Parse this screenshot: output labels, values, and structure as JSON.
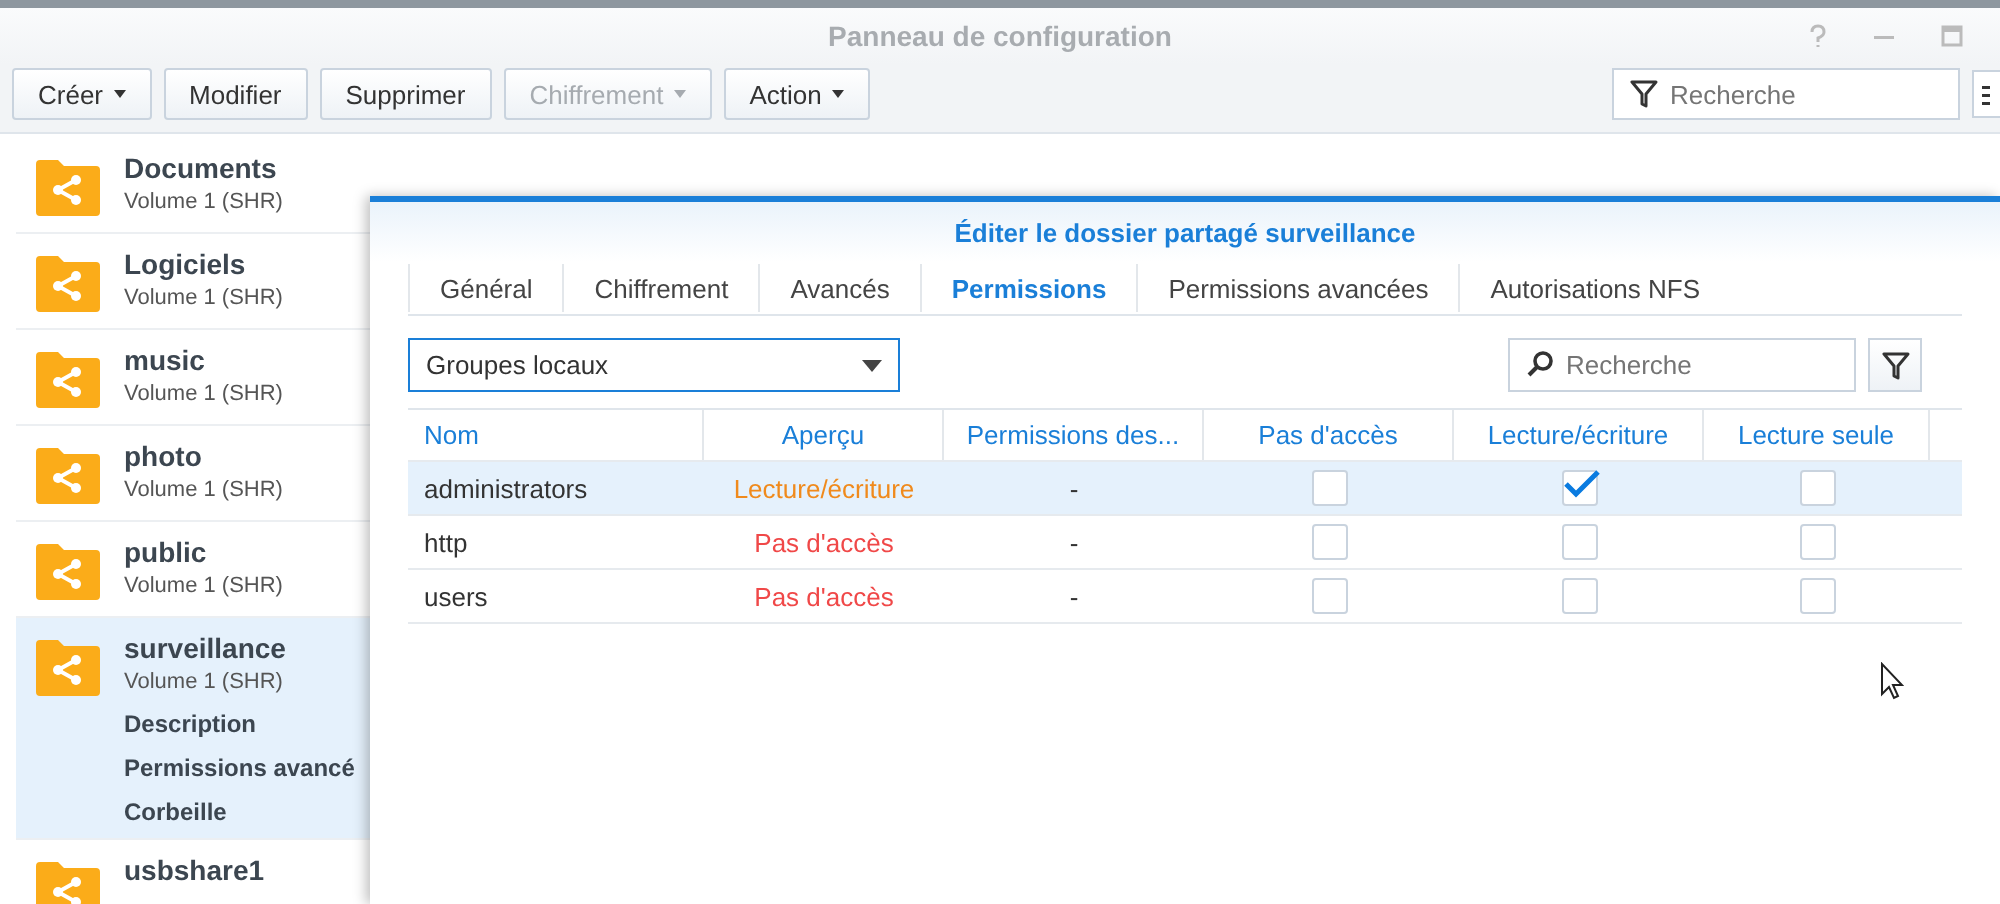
{
  "window": {
    "title": "Panneau de configuration"
  },
  "toolbar": {
    "buttons": [
      {
        "label": "Créer",
        "dropdown": true,
        "disabled": false
      },
      {
        "label": "Modifier",
        "dropdown": false,
        "disabled": false
      },
      {
        "label": "Supprimer",
        "dropdown": false,
        "disabled": false
      },
      {
        "label": "Chiffrement",
        "dropdown": true,
        "disabled": true
      },
      {
        "label": "Action",
        "dropdown": true,
        "disabled": false
      }
    ],
    "search": {
      "placeholder": "Recherche"
    }
  },
  "shares": [
    {
      "name": "Documents",
      "volume": "Volume 1 (SHR)",
      "selected": false
    },
    {
      "name": "Logiciels",
      "volume": "Volume 1 (SHR)",
      "selected": false
    },
    {
      "name": "music",
      "volume": "Volume 1 (SHR)",
      "selected": false
    },
    {
      "name": "photo",
      "volume": "Volume 1 (SHR)",
      "selected": false
    },
    {
      "name": "public",
      "volume": "Volume 1 (SHR)",
      "selected": false
    },
    {
      "name": "surveillance",
      "volume": "Volume 1 (SHR)",
      "selected": true,
      "details": [
        "Description",
        "Permissions avancé",
        "Corbeille"
      ]
    },
    {
      "name": "usbshare1",
      "selected": false
    }
  ],
  "dialog": {
    "title": "Éditer le dossier partagé surveillance",
    "tabs": [
      {
        "label": "Général",
        "selected": false
      },
      {
        "label": "Chiffrement",
        "selected": false
      },
      {
        "label": "Avancés",
        "selected": false
      },
      {
        "label": "Permissions",
        "selected": true
      },
      {
        "label": "Permissions avancées",
        "selected": false
      },
      {
        "label": "Autorisations NFS",
        "selected": false
      }
    ],
    "group_select": {
      "value": "Groupes locaux"
    },
    "search": {
      "placeholder": "Recherche"
    },
    "table": {
      "columns": [
        "Nom",
        "Aperçu",
        "Permissions des...",
        "Pas d'accès",
        "Lecture/écriture",
        "Lecture seule"
      ],
      "rows": [
        {
          "name": "administrators",
          "preview": "Lecture/écriture",
          "kind": "read_write",
          "permissions": "-",
          "no_access": false,
          "read_write": true,
          "read_only": false,
          "selected": true
        },
        {
          "name": "http",
          "preview": "Pas d'accès",
          "kind": "no_access",
          "permissions": "-",
          "no_access": false,
          "read_write": false,
          "read_only": false,
          "selected": false
        },
        {
          "name": "users",
          "preview": "Pas d'accès",
          "kind": "no_access",
          "permissions": "-",
          "no_access": false,
          "read_write": false,
          "read_only": false,
          "selected": false
        }
      ]
    }
  }
}
